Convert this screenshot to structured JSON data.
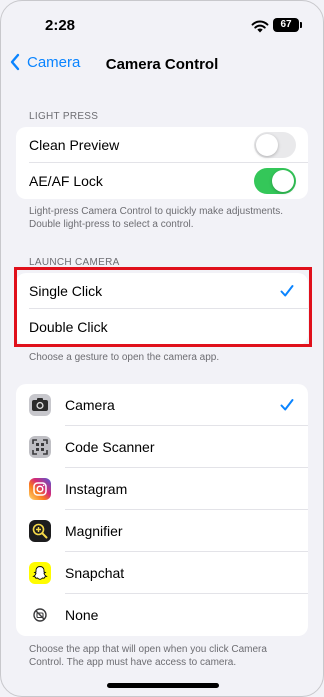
{
  "status": {
    "time": "2:28",
    "battery": "67"
  },
  "nav": {
    "back_label": "Camera",
    "title": "Camera Control"
  },
  "light_press": {
    "header": "LIGHT PRESS",
    "items": [
      {
        "label": "Clean Preview",
        "state": "off"
      },
      {
        "label": "AE/AF Lock",
        "state": "on"
      }
    ],
    "footer": "Light-press Camera Control to quickly make adjustments. Double light-press to select a control."
  },
  "launch_camera": {
    "header": "LAUNCH CAMERA",
    "items": [
      {
        "label": "Single Click",
        "selected": true
      },
      {
        "label": "Double Click",
        "selected": false
      }
    ],
    "footer": "Choose a gesture to open the camera app."
  },
  "apps": {
    "items": [
      {
        "label": "Camera",
        "icon": "camera-icon",
        "selected": true
      },
      {
        "label": "Code Scanner",
        "icon": "code-scanner-icon",
        "selected": false
      },
      {
        "label": "Instagram",
        "icon": "instagram-icon",
        "selected": false
      },
      {
        "label": "Magnifier",
        "icon": "magnifier-icon",
        "selected": false
      },
      {
        "label": "Snapchat",
        "icon": "snapchat-icon",
        "selected": false
      },
      {
        "label": "None",
        "icon": "none-icon",
        "selected": false
      }
    ],
    "footer": "Choose the app that will open when you click Camera Control. The app must have access to camera."
  },
  "colors": {
    "accent": "#0a84ff",
    "toggle_on": "#34c759",
    "highlight": "#e0101b"
  }
}
